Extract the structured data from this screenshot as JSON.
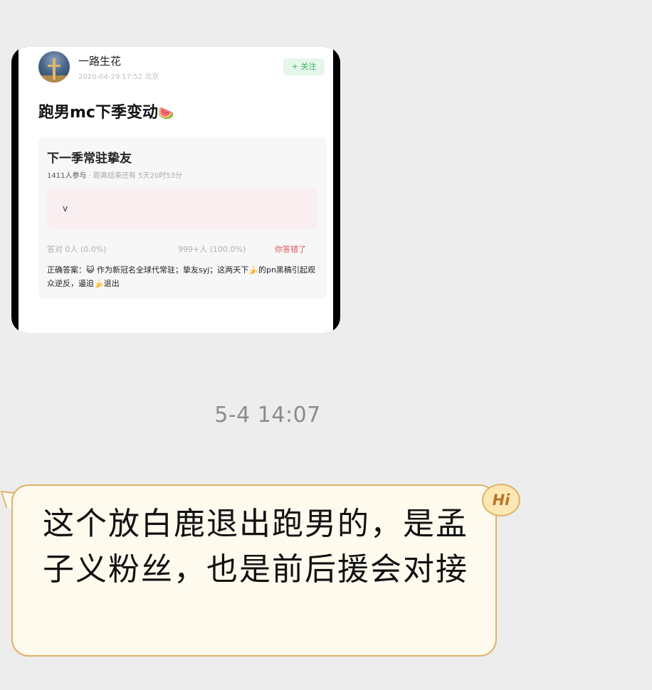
{
  "image_message": {
    "user_name": "一路生花",
    "post_time": "2020-04-29 17:52 北京",
    "follow_label": "+ 关注",
    "post_title": "跑男mc下季变动",
    "post_title_emoji": "🍉",
    "poll": {
      "title": "下一季常驻挚友",
      "participants": "1411人参与",
      "deadline": "· 距离结束还有 5天20时53分",
      "option": "v",
      "correct_count": "答对 0人 (0.0%)",
      "wrong_count": "999+人 (100.0%)",
      "wrong_label": "你答错了",
      "answer": "正确答案：😺 作为新冠名全球代常驻；挚友syj；这两天下🍌的pn黑稿引起观众逆反，逼迫🍌退出"
    }
  },
  "timestamp": "5-4 14:07",
  "text_message": {
    "text": "这个放白鹿退出跑男的，是孟子义粉丝，也是前后援会对接",
    "badge": "Hi"
  }
}
